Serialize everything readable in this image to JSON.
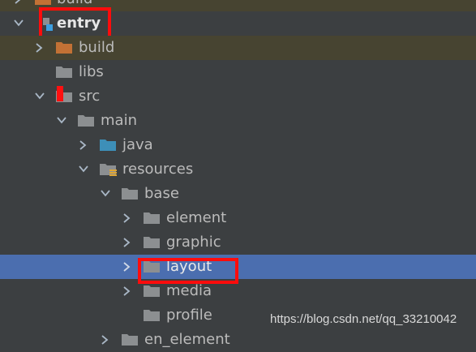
{
  "tree": {
    "build_top": {
      "label": "build",
      "expanded": false
    },
    "entry": {
      "label": "entry",
      "expanded": true
    },
    "build": {
      "label": "build",
      "expanded": false
    },
    "libs": {
      "label": "libs"
    },
    "src": {
      "label": "src",
      "expanded": true
    },
    "main": {
      "label": "main",
      "expanded": true
    },
    "java": {
      "label": "java",
      "expanded": false
    },
    "resources": {
      "label": "resources",
      "expanded": true
    },
    "base": {
      "label": "base",
      "expanded": true
    },
    "element": {
      "label": "element",
      "expanded": false
    },
    "graphic": {
      "label": "graphic",
      "expanded": false
    },
    "layout": {
      "label": "layout",
      "expanded": false,
      "selected": true
    },
    "media": {
      "label": "media",
      "expanded": false
    },
    "profile": {
      "label": "profile"
    },
    "en_element": {
      "label": "en_element",
      "expanded": false
    }
  },
  "icons": {
    "folder": "folder-icon",
    "build_folder": "orange-folder-icon",
    "module": "module-icon",
    "source_folder": "blue-folder-icon",
    "resources_folder": "resources-folder-icon"
  },
  "colors": {
    "background": "#3c3f41",
    "excluded_row": "#474431",
    "selected_row": "#4b6eaf",
    "annotation": "#ff0c0c",
    "folder_gray": "#8c8f91",
    "folder_orange": "#c27135",
    "folder_blue": "#3d8fb8"
  },
  "watermark": "https://blog.csdn.net/qq_33210042"
}
